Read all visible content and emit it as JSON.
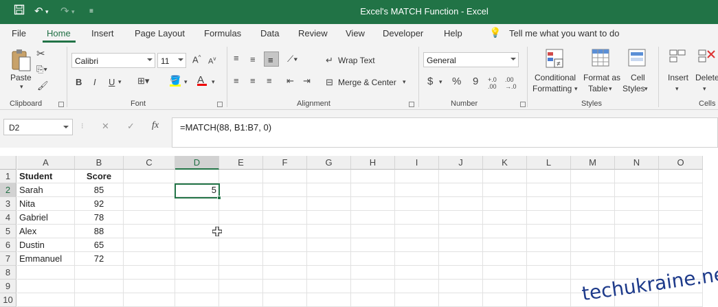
{
  "titlebar": {
    "title": "Excel's MATCH Function  -  Excel",
    "save_icon": "save-icon",
    "undo_icon": "undo-icon",
    "redo_icon": "redo-icon",
    "customize_icon": "customize-qat-icon"
  },
  "tabs": [
    "File",
    "Home",
    "Insert",
    "Page Layout",
    "Formulas",
    "Data",
    "Review",
    "View",
    "Developer",
    "Help"
  ],
  "active_tab": "Home",
  "tell_me": "Tell me what you want to do",
  "ribbon": {
    "clipboard": {
      "paste": "Paste",
      "label": "Clipboard"
    },
    "font": {
      "name": "Calibri",
      "size": "11",
      "bold": "B",
      "italic": "I",
      "underline": "U",
      "label": "Font"
    },
    "alignment": {
      "wrap": "Wrap Text",
      "merge": "Merge & Center",
      "label": "Alignment"
    },
    "number": {
      "format": "General",
      "currency": "$",
      "percent": "%",
      "comma": "9",
      "label": "Number"
    },
    "styles": {
      "conditional_1": "Conditional",
      "conditional_2": "Formatting",
      "format_table_1": "Format as",
      "format_table_2": "Table",
      "cell_styles_1": "Cell",
      "cell_styles_2": "Styles",
      "label": "Styles"
    },
    "cells": {
      "insert": "Insert",
      "delete": "Delete",
      "label": "Cells"
    }
  },
  "formula_bar": {
    "name_box": "D2",
    "cancel": "✕",
    "enter": "✓",
    "fx": "fx",
    "formula": "=MATCH(88, B1:B7, 0)"
  },
  "sheet": {
    "columns": [
      "A",
      "B",
      "C",
      "D",
      "E",
      "F",
      "G",
      "H",
      "I",
      "J",
      "K",
      "L",
      "M",
      "N",
      "O"
    ],
    "rows": [
      "1",
      "2",
      "3",
      "4",
      "5",
      "6",
      "7",
      "8",
      "9",
      "10"
    ],
    "active_cell": "D2",
    "cells": {
      "A1": "Student",
      "B1": "Score",
      "A2": "Sarah",
      "B2": "85",
      "D2": "5",
      "A3": "Nita",
      "B3": "92",
      "A4": "Gabriel",
      "B4": "78",
      "A5": "Alex",
      "B5": "88",
      "A6": "Dustin",
      "B6": "65",
      "A7": "Emmanuel",
      "B7": "72"
    }
  },
  "watermark": "techukraine.net"
}
